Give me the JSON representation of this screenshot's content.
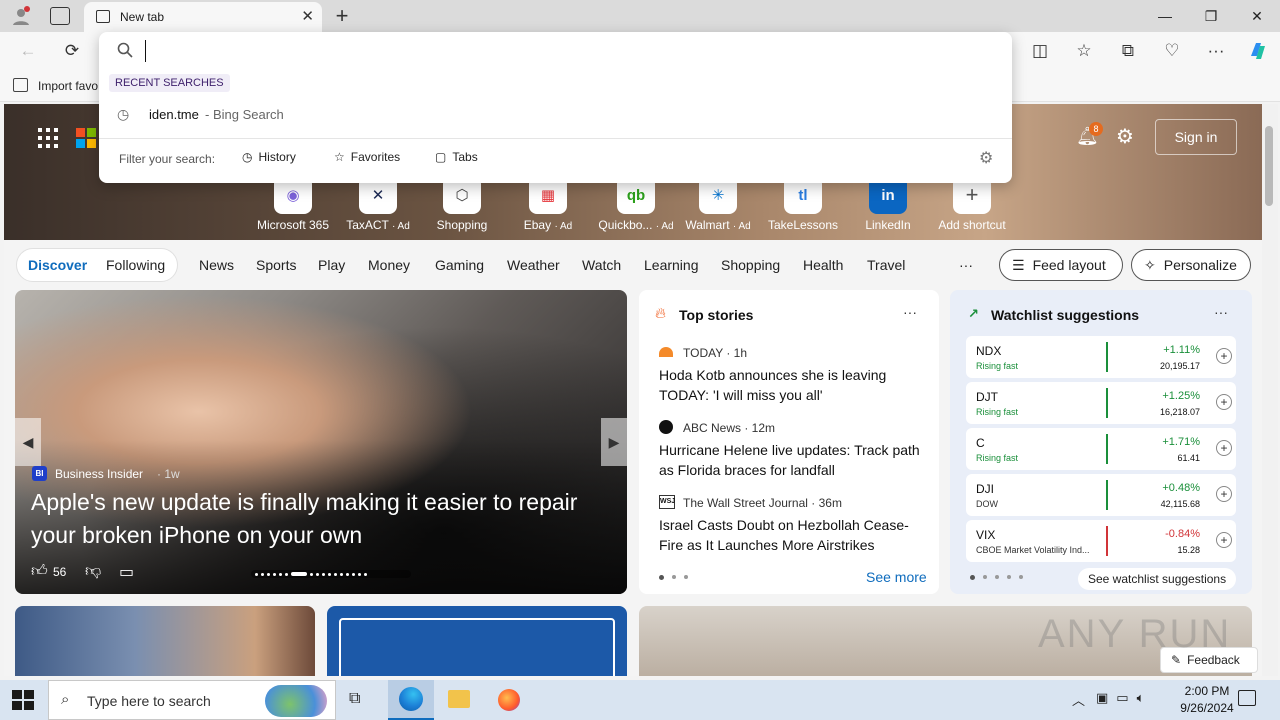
{
  "browser": {
    "tab_title": "New tab",
    "address_value": "",
    "favbar_item": "Import favo"
  },
  "omnibox": {
    "recent_header": "RECENT SEARCHES",
    "recent_query": "iden.tme",
    "recent_suffix": "- Bing Search",
    "filter_label": "Filter your search:",
    "filters": [
      "History",
      "Favorites",
      "Tabs"
    ]
  },
  "header": {
    "notifications_count": "8",
    "sign_in": "Sign in"
  },
  "shortcuts": [
    {
      "label": "Microsoft 365",
      "ad": "",
      "icon": "microsoft-365-icon",
      "color": "#7b61d9"
    },
    {
      "label": "TaxACT",
      "ad": "· Ad",
      "icon": "taxact-icon",
      "color": "#1d2a55"
    },
    {
      "label": "Shopping",
      "ad": "",
      "icon": "shopping-tag-icon",
      "color": "#444"
    },
    {
      "label": "Ebay",
      "ad": "· Ad",
      "icon": "ebay-icon",
      "color": "#e53238"
    },
    {
      "label": "Quickbo...",
      "ad": "· Ad",
      "icon": "quickbooks-icon",
      "color": "#2ca01c"
    },
    {
      "label": "Walmart",
      "ad": "· Ad",
      "icon": "walmart-icon",
      "color": "#0071ce"
    },
    {
      "label": "TakeLessons",
      "ad": "",
      "icon": "takelessons-icon",
      "color": "#2a7de1"
    },
    {
      "label": "LinkedIn",
      "ad": "",
      "icon": "linkedin-icon",
      "color": "#0a66c2"
    },
    {
      "label": "Add shortcut",
      "ad": "",
      "icon": "plus-icon",
      "color": "#555"
    }
  ],
  "nav": {
    "discover": "Discover",
    "following": "Following",
    "items": [
      "News",
      "Sports",
      "Play",
      "Money",
      "Gaming",
      "Weather",
      "Watch",
      "Learning",
      "Shopping",
      "Health",
      "Travel"
    ],
    "more": "···",
    "feed_layout": "Feed layout",
    "personalize": "Personalize"
  },
  "hero": {
    "source": "Business Insider",
    "age": "· 1w",
    "title": "Apple's new update is finally making it easier to repair your broken iPhone on your own",
    "likes": "56"
  },
  "top_stories": {
    "title": "Top stories",
    "items": [
      {
        "source": "TODAY · 1h",
        "title": "Hoda Kotb announces she is leaving TODAY: 'I will miss you all'"
      },
      {
        "source": "ABC News · 12m",
        "title": "Hurricane Helene live updates: Track path as Florida braces for landfall"
      },
      {
        "source": "The Wall Street Journal · 36m",
        "title": "Israel Casts Doubt on Hezbollah Cease-Fire as It Launches More Airstrikes"
      }
    ],
    "see_more": "See more"
  },
  "watchlist": {
    "title": "Watchlist suggestions",
    "stocks": [
      {
        "symbol": "NDX",
        "sub": "Rising fast",
        "change": "+1.11%",
        "price": "20,195.17",
        "up": true
      },
      {
        "symbol": "DJT",
        "sub": "Rising fast",
        "change": "+1.25%",
        "price": "16,218.07",
        "up": true
      },
      {
        "symbol": "C",
        "sub": "Rising fast",
        "change": "+1.71%",
        "price": "61.41",
        "up": true
      },
      {
        "symbol": "DJI",
        "sub": "DOW",
        "change": "+0.48%",
        "price": "42,115.68",
        "up": true
      },
      {
        "symbol": "VIX",
        "sub": "CBOE Market Volatility Ind...",
        "change": "-0.84%",
        "price": "15.28",
        "up": false
      }
    ],
    "see_suggestions": "See watchlist suggestions"
  },
  "feedback": "Feedback",
  "watermark": "ANY RUN",
  "taskbar": {
    "search_placeholder": "Type here to search",
    "time": "2:00 PM",
    "date": "9/26/2024"
  },
  "colors": {
    "accent": "#0f6cbd",
    "up": "#1a8f3a",
    "down": "#d13438"
  }
}
